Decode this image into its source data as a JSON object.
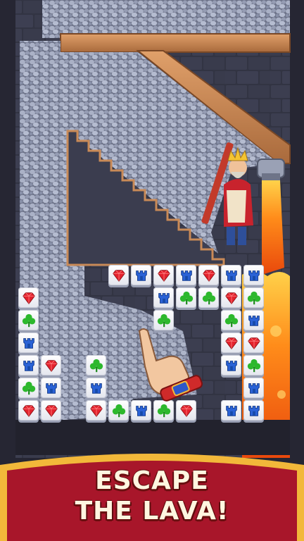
{
  "banner": {
    "line1": "ESCAPE",
    "line2": "THE LAVA!"
  },
  "colors": {
    "wall_dark": "#2a2a38",
    "stone": "#3f4152",
    "gravel": "#8b93ab",
    "wood": "#c98a57",
    "lava": "#ff7a12",
    "banner_red": "#a8162a",
    "banner_gold": "#f2b83a"
  },
  "board": {
    "rows": [
      {
        "row": 0,
        "cells": [
          [
            4,
            "gem"
          ],
          [
            5,
            "tower"
          ],
          [
            6,
            "gem"
          ],
          [
            7,
            "tower"
          ],
          [
            8,
            "gem"
          ],
          [
            9,
            "tower"
          ],
          [
            10,
            "tower"
          ]
        ]
      },
      {
        "row": 1,
        "cells": [
          [
            0,
            "gem"
          ],
          [
            6,
            "tower"
          ],
          [
            7,
            "clover"
          ],
          [
            8,
            "clover"
          ],
          [
            9,
            "gem"
          ],
          [
            10,
            "clover"
          ]
        ]
      },
      {
        "row": 2,
        "cells": [
          [
            0,
            "clover"
          ],
          [
            6,
            "clover"
          ],
          [
            9,
            "clover"
          ],
          [
            10,
            "tower"
          ]
        ]
      },
      {
        "row": 3,
        "cells": [
          [
            0,
            "tower"
          ],
          [
            9,
            "gem"
          ],
          [
            10,
            "gem"
          ]
        ]
      },
      {
        "row": 4,
        "cells": [
          [
            0,
            "tower"
          ],
          [
            1,
            "gem"
          ],
          [
            3,
            "clover"
          ],
          [
            9,
            "tower"
          ],
          [
            10,
            "clover"
          ]
        ]
      },
      {
        "row": 5,
        "cells": [
          [
            0,
            "clover"
          ],
          [
            1,
            "tower"
          ],
          [
            3,
            "tower"
          ],
          [
            10,
            "tower"
          ]
        ]
      },
      {
        "row": 6,
        "cells": [
          [
            0,
            "gem"
          ],
          [
            1,
            "gem"
          ],
          [
            3,
            "gem"
          ],
          [
            4,
            "clover"
          ],
          [
            5,
            "tower"
          ],
          [
            6,
            "clover"
          ],
          [
            7,
            "gem"
          ],
          [
            9,
            "tower"
          ],
          [
            10,
            "tower"
          ]
        ]
      }
    ]
  },
  "icons": [
    "gem-icon",
    "tower-icon",
    "clover-icon",
    "pointing-hand-icon",
    "king-character",
    "lava-pipe"
  ]
}
